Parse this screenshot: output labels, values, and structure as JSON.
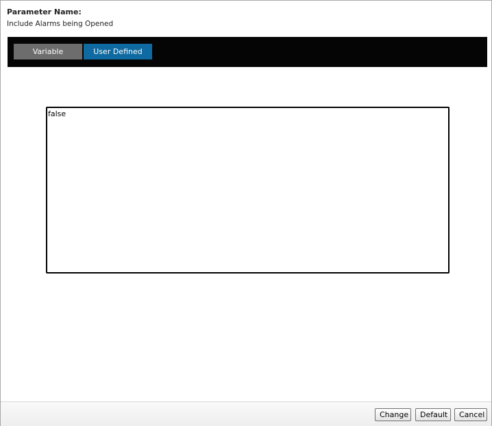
{
  "parameter": {
    "label": "Parameter Name:",
    "name": "Include Alarms being Opened"
  },
  "tabs": {
    "variable": "Variable",
    "user_defined": "User Defined",
    "active": "user_defined"
  },
  "editor": {
    "value": "false"
  },
  "footer": {
    "change_label": "Change",
    "default_label": "Default",
    "cancel_label": "Cancel"
  },
  "colors": {
    "tab_bar_bg": "#050505",
    "tab_inactive_bg": "#6d6d6d",
    "tab_active_bg": "#0e6aa0"
  }
}
